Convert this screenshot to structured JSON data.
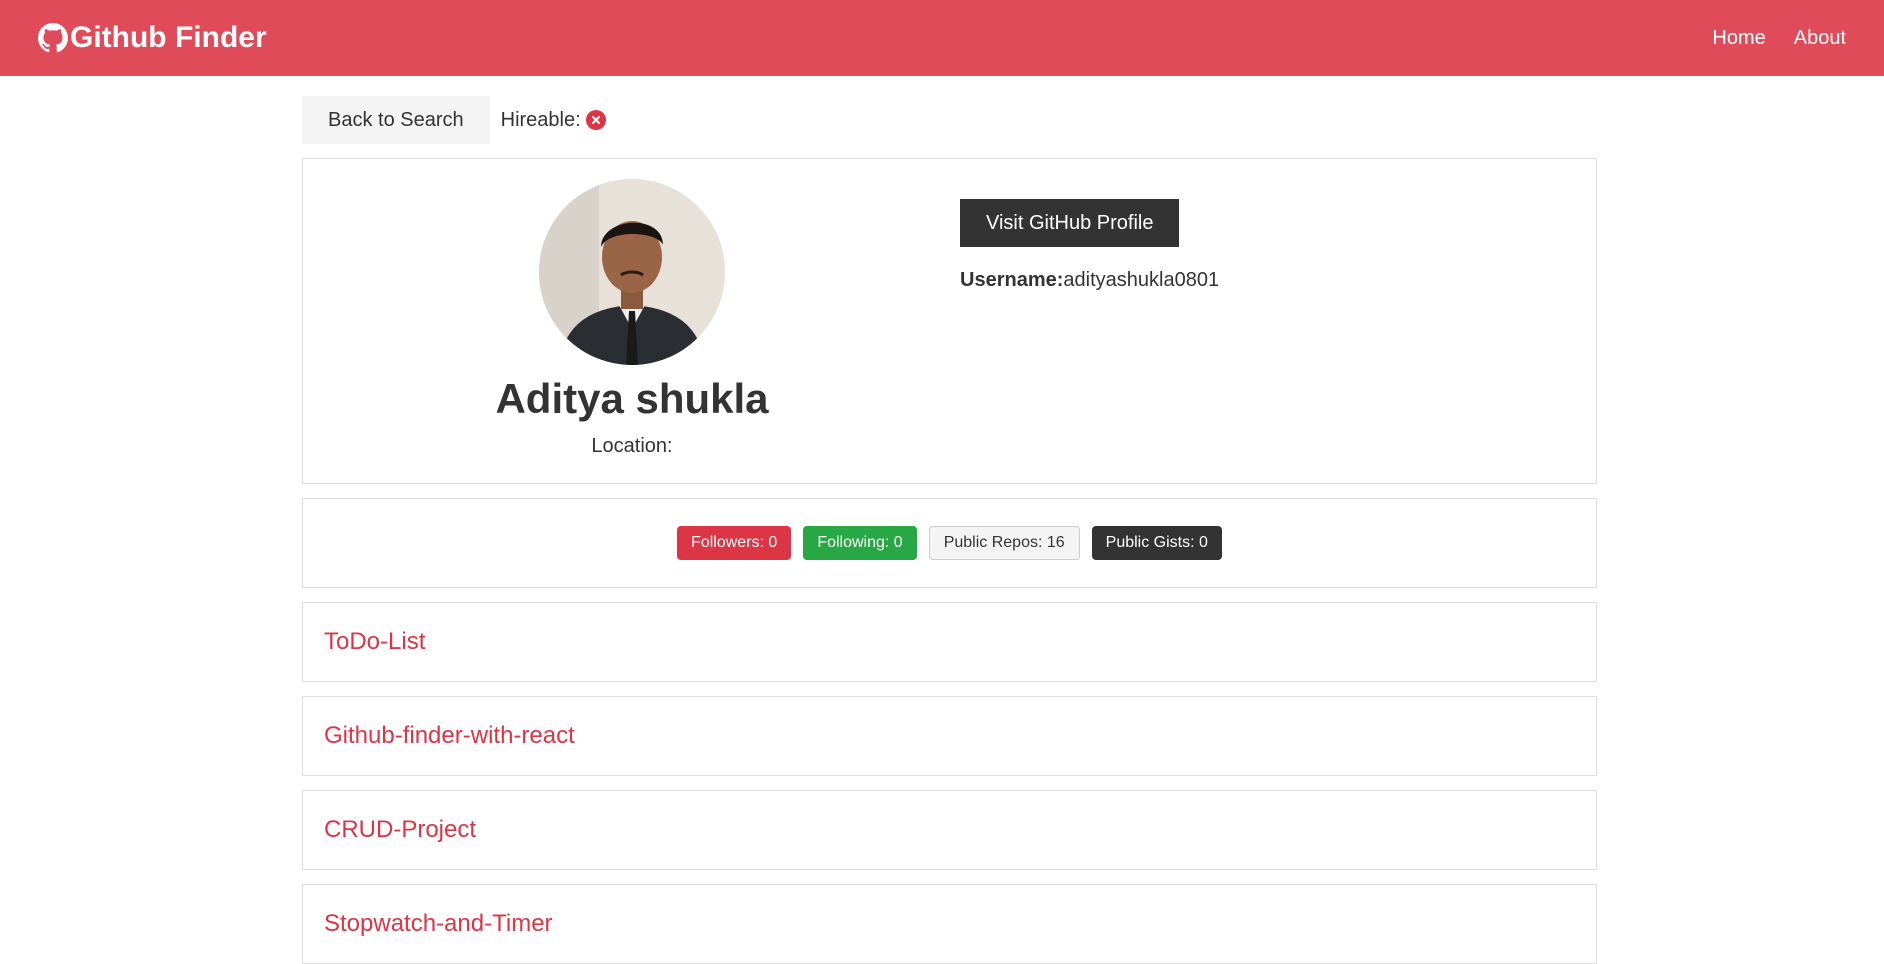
{
  "navbar": {
    "brand": "Github Finder",
    "brand_icon": "github-icon",
    "links": [
      "Home",
      "About"
    ],
    "color": "#e04b5a"
  },
  "actions": {
    "back_label": "Back to Search",
    "hireable_label": "Hireable:",
    "hireable_icon": "times-circle-icon"
  },
  "profile": {
    "name": "Aditya shukla",
    "location_label": "Location:",
    "visit_label": "Visit GitHub Profile",
    "username_label": "Username:",
    "username": "adityashukla0801"
  },
  "stats": {
    "followers": "Followers: 0",
    "following": "Following: 0",
    "repos": "Public Repos: 16",
    "gists": "Public Gists: 0"
  },
  "repos": [
    {
      "name": "ToDo-List"
    },
    {
      "name": "Github-finder-with-react"
    },
    {
      "name": "CRUD-Project"
    },
    {
      "name": "Stopwatch-and-Timer"
    }
  ],
  "colors": {
    "accent": "#dc3545",
    "success": "#28a745",
    "dark": "#333333",
    "light": "#f4f4f4"
  }
}
